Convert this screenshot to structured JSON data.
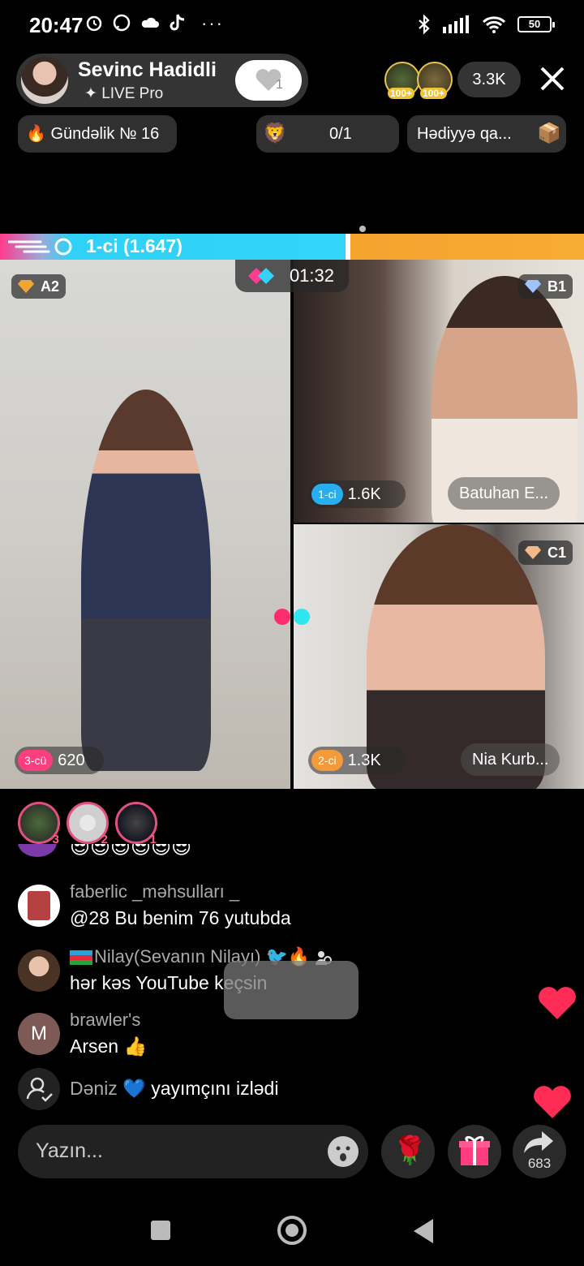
{
  "status_bar": {
    "time": "20:47",
    "icons": [
      "alarm-icon",
      "whatsapp-icon",
      "cloud-icon",
      "tiktok-icon",
      "more-icon"
    ],
    "battery": "50"
  },
  "host": {
    "name": "Sevinc Hadidli",
    "subtitle": "LIVE Pro",
    "follow_count": "1"
  },
  "viewers": {
    "badge1": "100+",
    "badge2": "100+",
    "count": "3.3K"
  },
  "chips": {
    "daily": "Gündəlik № 16",
    "goal": "0/1",
    "gift": "Hədiyyə qa..."
  },
  "battle": {
    "leader_text": "1-ci (1.647)",
    "timer": "01:32",
    "leader_fraction": 0.6
  },
  "players": [
    {
      "tag": "A2",
      "rank": "3-cü",
      "score": "620",
      "name": ""
    },
    {
      "tag": "B1",
      "rank": "1-ci",
      "score": "1.6K",
      "name": "Batuhan E..."
    },
    {
      "tag": "C1",
      "rank": "2-ci",
      "score": "1.3K",
      "name": "Nia Kurb..."
    }
  ],
  "gifters": [
    "3",
    "2",
    "1"
  ],
  "chat": [
    {
      "user": "faberlic _məhsulları _",
      "message": "@28 Bu benim 76 yutubda"
    },
    {
      "user": "Nilay(Sevanın Nilayı)",
      "message": "hər kəs YouTube keçsin"
    },
    {
      "user": "brawler's",
      "avatar_letter": "M",
      "message": "Arsen 👍"
    }
  ],
  "follow_event": {
    "user": "Dəniz",
    "text": "yayımçını izlədi"
  },
  "input": {
    "placeholder": "Yazın..."
  },
  "share_count": "683",
  "colors": {
    "left_team": "#2fd1f6",
    "right_team": "#f5a32e",
    "pink": "#ff3c8e",
    "heart": "#ff2d55"
  }
}
